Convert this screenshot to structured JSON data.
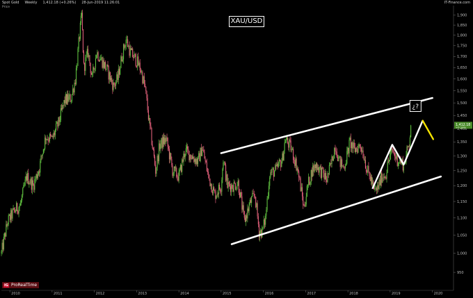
{
  "header": {
    "instrument": "Spot Gold",
    "period": "Weekly",
    "last_change": "1,412.18 (+0.26%)",
    "datetime": "28-Jun-2019 11:26:01",
    "source": "IT-Finance.com",
    "price_label": "Price"
  },
  "title_box": "XAU/USD",
  "question_box": "¿?",
  "logo": {
    "badge": "IG",
    "text": "ProRealTime"
  },
  "price_tag": {
    "value": "1,412.18",
    "change": "+0.26%"
  },
  "colors": {
    "background": "#000000",
    "bull": "#5fbf3f",
    "bear": "#e0607a",
    "channel": "#ffffff",
    "projection": "#ffffff",
    "projection_last": "#f5e400",
    "price_tag_bg": "#4a8a2a"
  },
  "chart_data": {
    "type": "line",
    "title": "XAU/USD",
    "xlabel": "",
    "ylabel": "",
    "x_ticks": [
      "2010",
      "2011",
      "2012",
      "2013",
      "2014",
      "2015",
      "2016",
      "2017",
      "2018",
      "2019",
      "2020"
    ],
    "y_ticks": [
      950,
      1000,
      1050,
      1100,
      1150,
      1200,
      1250,
      1300,
      1350,
      1400,
      1450,
      1500,
      1550,
      1600,
      1650,
      1700,
      1750,
      1800,
      1850,
      1900
    ],
    "y_tick_labels": [
      "950",
      "1,000",
      "1,050",
      "1,100",
      "1,150",
      "1,200",
      "1,250",
      "1,300",
      "1,350",
      "1,400",
      "1,450",
      "1,500",
      "1,550",
      "1,600",
      "1,650",
      "1,700",
      "1,750",
      "1,800",
      "1,850",
      "1,900"
    ],
    "ylim": [
      905,
      1950
    ],
    "xlim": [
      2009.8,
      2020.5
    ],
    "scale": "log",
    "grid": false,
    "series": [
      {
        "kind": "candles",
        "approx_weekly_closes": [
          [
            2009.8,
            1000
          ],
          [
            2009.95,
            1090
          ],
          [
            2010.1,
            1120
          ],
          [
            2010.25,
            1140
          ],
          [
            2010.4,
            1230
          ],
          [
            2010.55,
            1200
          ],
          [
            2010.7,
            1260
          ],
          [
            2010.85,
            1370
          ],
          [
            2011.0,
            1360
          ],
          [
            2011.15,
            1420
          ],
          [
            2011.3,
            1510
          ],
          [
            2011.45,
            1520
          ],
          [
            2011.55,
            1600
          ],
          [
            2011.65,
            1800
          ],
          [
            2011.7,
            1900
          ],
          [
            2011.75,
            1650
          ],
          [
            2011.85,
            1720
          ],
          [
            2011.95,
            1600
          ],
          [
            2012.05,
            1720
          ],
          [
            2012.15,
            1690
          ],
          [
            2012.3,
            1640
          ],
          [
            2012.45,
            1570
          ],
          [
            2012.55,
            1600
          ],
          [
            2012.65,
            1700
          ],
          [
            2012.75,
            1780
          ],
          [
            2012.85,
            1720
          ],
          [
            2013.0,
            1680
          ],
          [
            2013.1,
            1640
          ],
          [
            2013.2,
            1560
          ],
          [
            2013.3,
            1420
          ],
          [
            2013.45,
            1250
          ],
          [
            2013.55,
            1340
          ],
          [
            2013.7,
            1360
          ],
          [
            2013.85,
            1250
          ],
          [
            2014.0,
            1230
          ],
          [
            2014.15,
            1320
          ],
          [
            2014.3,
            1300
          ],
          [
            2014.45,
            1280
          ],
          [
            2014.55,
            1330
          ],
          [
            2014.7,
            1230
          ],
          [
            2014.85,
            1170
          ],
          [
            2015.0,
            1200
          ],
          [
            2015.05,
            1290
          ],
          [
            2015.15,
            1200
          ],
          [
            2015.3,
            1200
          ],
          [
            2015.4,
            1210
          ],
          [
            2015.55,
            1090
          ],
          [
            2015.7,
            1150
          ],
          [
            2015.8,
            1170
          ],
          [
            2015.9,
            1060
          ],
          [
            2015.97,
            1060
          ],
          [
            2016.05,
            1100
          ],
          [
            2016.15,
            1240
          ],
          [
            2016.3,
            1250
          ],
          [
            2016.45,
            1290
          ],
          [
            2016.52,
            1360
          ],
          [
            2016.65,
            1330
          ],
          [
            2016.8,
            1260
          ],
          [
            2016.9,
            1180
          ],
          [
            2016.96,
            1130
          ],
          [
            2017.05,
            1200
          ],
          [
            2017.15,
            1250
          ],
          [
            2017.25,
            1270
          ],
          [
            2017.4,
            1240
          ],
          [
            2017.5,
            1220
          ],
          [
            2017.6,
            1270
          ],
          [
            2017.7,
            1340
          ],
          [
            2017.8,
            1280
          ],
          [
            2017.9,
            1260
          ],
          [
            2017.96,
            1290
          ],
          [
            2018.05,
            1350
          ],
          [
            2018.15,
            1320
          ],
          [
            2018.3,
            1340
          ],
          [
            2018.4,
            1290
          ],
          [
            2018.45,
            1250
          ],
          [
            2018.55,
            1220
          ],
          [
            2018.62,
            1180
          ],
          [
            2018.7,
            1190
          ],
          [
            2018.8,
            1230
          ],
          [
            2018.9,
            1240
          ],
          [
            2018.96,
            1280
          ],
          [
            2019.05,
            1320
          ],
          [
            2019.15,
            1290
          ],
          [
            2019.25,
            1280
          ],
          [
            2019.32,
            1270
          ],
          [
            2019.38,
            1300
          ],
          [
            2019.45,
            1350
          ],
          [
            2019.49,
            1412
          ]
        ]
      }
    ],
    "channel": {
      "upper": [
        [
          2015.0,
          1310
        ],
        [
          2020.0,
          1520
        ]
      ],
      "lower": [
        [
          2015.25,
          1025
        ],
        [
          2020.2,
          1230
        ]
      ]
    },
    "projection_path": [
      [
        2018.58,
        1190
      ],
      [
        2019.05,
        1340
      ],
      [
        2019.32,
        1270
      ],
      [
        2019.77,
        1430
      ]
    ],
    "projection_last_leg": [
      [
        2019.77,
        1430
      ],
      [
        2020.02,
        1360
      ]
    ],
    "last_price": 1412.18
  }
}
